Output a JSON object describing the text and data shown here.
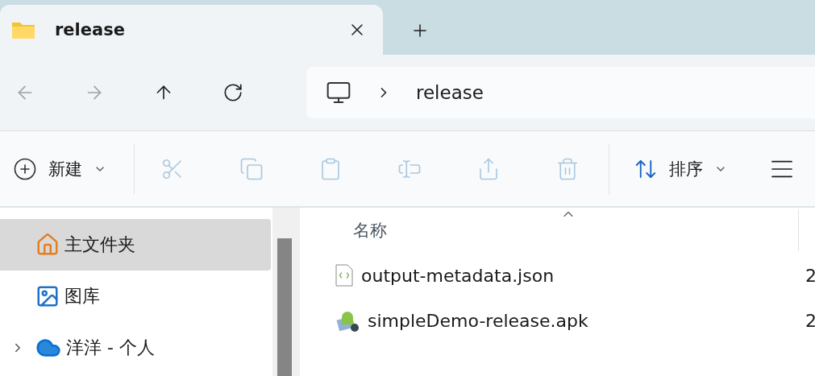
{
  "tabs": [
    {
      "title": "release",
      "selected": true
    }
  ],
  "nav": [
    {
      "kind": "back",
      "disabled": true
    },
    {
      "kind": "forward",
      "disabled": true
    },
    {
      "kind": "up",
      "disabled": false
    },
    {
      "kind": "refresh",
      "disabled": false
    }
  ],
  "address": {
    "path": [
      "release"
    ]
  },
  "toolbar": {
    "new_label": "新建",
    "sort_label": "排序",
    "actions": [
      {
        "kind": "cut",
        "disabled": true
      },
      {
        "kind": "copy",
        "disabled": true
      },
      {
        "kind": "paste",
        "disabled": true
      },
      {
        "kind": "rename",
        "disabled": true
      },
      {
        "kind": "share",
        "disabled": true
      },
      {
        "kind": "delete",
        "disabled": true
      }
    ]
  },
  "sidebar": {
    "items": [
      {
        "label": "主文件夹",
        "kind": "home",
        "selected": true
      },
      {
        "label": "图库",
        "kind": "gallery",
        "selected": false
      },
      {
        "label": "洋洋 - 个人",
        "kind": "cloud",
        "selected": false,
        "expanded": false
      }
    ]
  },
  "files": {
    "columns": [
      "名称"
    ],
    "rows": [
      {
        "name": "output-metadata.json",
        "kind": "json",
        "column_2": "2"
      },
      {
        "name": "simpleDemo-release.apk",
        "kind": "apk",
        "column_2": "2"
      }
    ]
  }
}
